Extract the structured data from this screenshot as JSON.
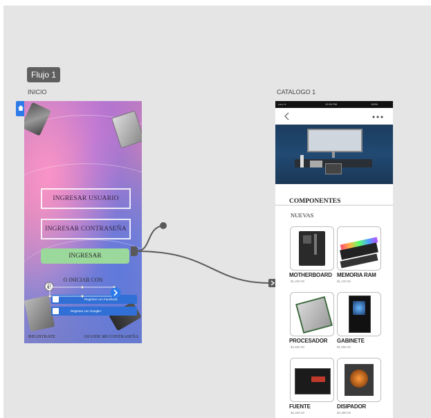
{
  "flow_badge": "Flujo 1",
  "artboards": {
    "inicio_label": "INICIO",
    "catalogo_label": "CATALOGO 1"
  },
  "login": {
    "user_button": "INGRESAR USUARIO",
    "password_button": "INGRESAR CONTRASEÑA",
    "submit_button": "INGRESAR",
    "alt_login_text": "O INICIAR CON",
    "facebook_button": "Registrar con Facebook",
    "google_button": "Registrar con Google+",
    "register_link": "REGISTRATE",
    "forgot_link": "OLVIDE MI CONTRASEÑA"
  },
  "catalog": {
    "status_time": "12:00 PM",
    "status_signal": "••••• ᯤ",
    "status_battery": "100%",
    "section_title": "COMPONENTES",
    "subsection_title": "NUEVAS",
    "products": [
      {
        "name": "MOTHERBOARD",
        "price": "$1,400.00"
      },
      {
        "name": "MEMORIA RAM",
        "price": "$1,100.00"
      },
      {
        "name": "PROCESADOR",
        "price": "$4,600.00"
      },
      {
        "name": "GABINETE",
        "price": "$1,080.00"
      },
      {
        "name": "FUENTE",
        "price": "$3,400.00"
      },
      {
        "name": "DISIPADOR",
        "price": "$4,399.00"
      }
    ]
  },
  "colors": {
    "canvas": "#e5e5e5",
    "badge": "#5f5f5f",
    "home_tab": "#2d7be8",
    "submit_green": "#9bd89b",
    "social_blue": "#2f6fd6",
    "connector": "#595959"
  }
}
